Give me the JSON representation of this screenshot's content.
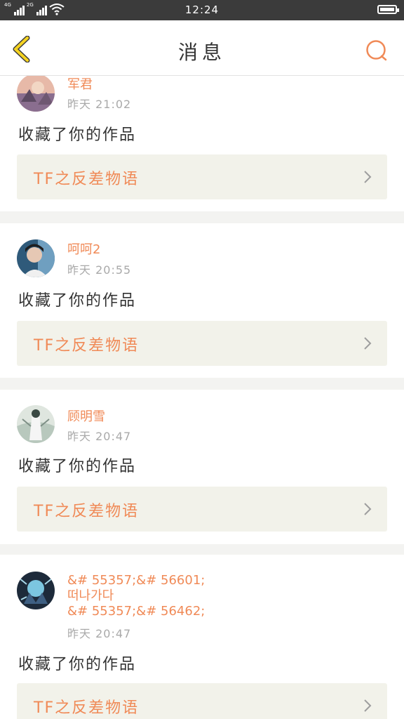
{
  "status_bar": {
    "network_1": "4G",
    "network_2": "2G",
    "time": "12:24"
  },
  "header": {
    "title": "消息"
  },
  "messages": [
    {
      "username": "军君",
      "time": "昨天  21:02",
      "action": "收藏了你的作品",
      "work_title": "TF之反差物语",
      "avatar_icon": "avatar-landscape"
    },
    {
      "username": "呵呵2",
      "time": "昨天  20:55",
      "action": "收藏了你的作品",
      "work_title": "TF之反差物语",
      "avatar_icon": "avatar-person"
    },
    {
      "username": "顾明雪",
      "time": "昨天  20:47",
      "action": "收藏了你的作品",
      "work_title": "TF之反差物语",
      "avatar_icon": "avatar-illustration"
    },
    {
      "username_line1": "&# 55357;&# 56601;",
      "username_line2": "떠나가다",
      "username_line3": "&# 55357;&# 56462;",
      "time": "昨天  20:47",
      "action": "收藏了你的作品",
      "work_title": "TF之反差物语",
      "avatar_icon": "avatar-dark-art"
    }
  ],
  "colors": {
    "accent": "#f08a57",
    "back_icon": "#f5d321",
    "work_bg": "#f2f2ea",
    "page_bg": "#f3f3f1",
    "status_bar": "#3b3b3b"
  }
}
